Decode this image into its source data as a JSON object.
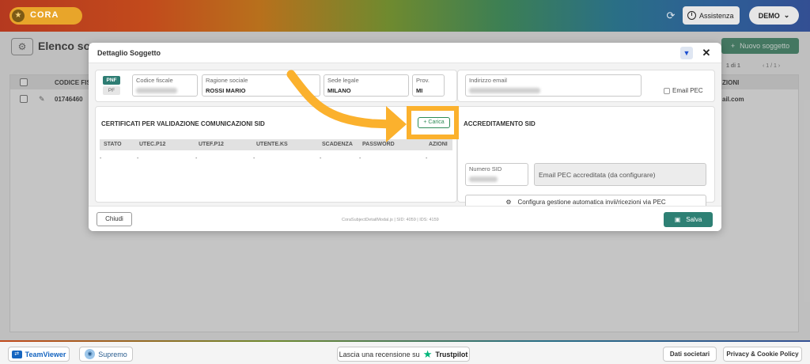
{
  "app": {
    "logo_text": "CORA",
    "assist_label": "Assistenza",
    "user_label": "DEMO"
  },
  "background": {
    "page_title": "Elenco sogg",
    "new_subject_label": "Nuovo soggetto",
    "pager_text": "1 di 1",
    "pager_pages": "1 / 1",
    "col_codice": "CODICE FIS",
    "col_right": "ZIONI",
    "row_codice": "01746460",
    "row_right": "ail.com"
  },
  "modal": {
    "title": "Dettaglio Soggetto",
    "person_type": {
      "active": "PNF",
      "inactive": "PF"
    },
    "fields": {
      "codice_fiscale": {
        "label": "Codice fiscale",
        "value": ""
      },
      "ragione_sociale": {
        "label": "Ragione sociale",
        "value": "ROSSI MARIO"
      },
      "sede_legale": {
        "label": "Sede legale",
        "value": "MILANO"
      },
      "prov": {
        "label": "Prov.",
        "value": "MI"
      },
      "indirizzo_email": {
        "label": "Indirizzo email",
        "value": ""
      },
      "email_pec_label": "Email PEC"
    },
    "certificati": {
      "title": "CERTIFICATI PER VALIDAZIONE COMUNICAZIONI SID",
      "upload_label": "+ Carica",
      "columns": [
        "STATO",
        "UTEC.P12",
        "UTEF.P12",
        "UTENTE.KS",
        "SCADENZA",
        "PASSWORD",
        "AZIONI"
      ],
      "row": [
        "-",
        "-",
        "-",
        "-",
        "-",
        "-",
        "-"
      ]
    },
    "accreditamento": {
      "title": "ACCREDITAMENTO SID",
      "numero_sid_label": "Numero SID",
      "pec_status": "Email PEC accreditata (da configurare)",
      "config_label": "Configura gestione automatica invii/ricezioni via PEC"
    },
    "footer": {
      "close_label": "Chiudi",
      "info": "CoraSubjectDetailModal.js | SID: 4059 | IDS: 4159",
      "save_label": "Salva"
    }
  },
  "bottom": {
    "teamviewer": "TeamViewer",
    "supremo": "Supremo",
    "review_text": "Lascia una recensione su",
    "trustpilot": "Trustpilot",
    "dati_societari": "Dati societari",
    "privacy": "Privacy & Cookie Policy"
  },
  "colors": {
    "accent_green": "#2e8074",
    "highlight": "#fbb12d",
    "carica_green": "#2e8b57"
  }
}
